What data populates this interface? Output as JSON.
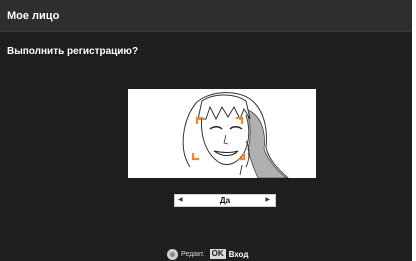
{
  "window": {
    "title": "Мое лицо"
  },
  "dialog": {
    "question": "Выполнить регистрацию?"
  },
  "selector": {
    "value": "Да",
    "left_arrow": "◀",
    "right_arrow": "▶"
  },
  "footer": {
    "edit_label": "Редакт.",
    "ok_badge": "OK",
    "enter_label": "Вход"
  },
  "colors": {
    "background": "#1e1e1e",
    "title_bar": "#2e2e2e",
    "accent_markers": "#f08a30",
    "text": "#ffffff"
  }
}
